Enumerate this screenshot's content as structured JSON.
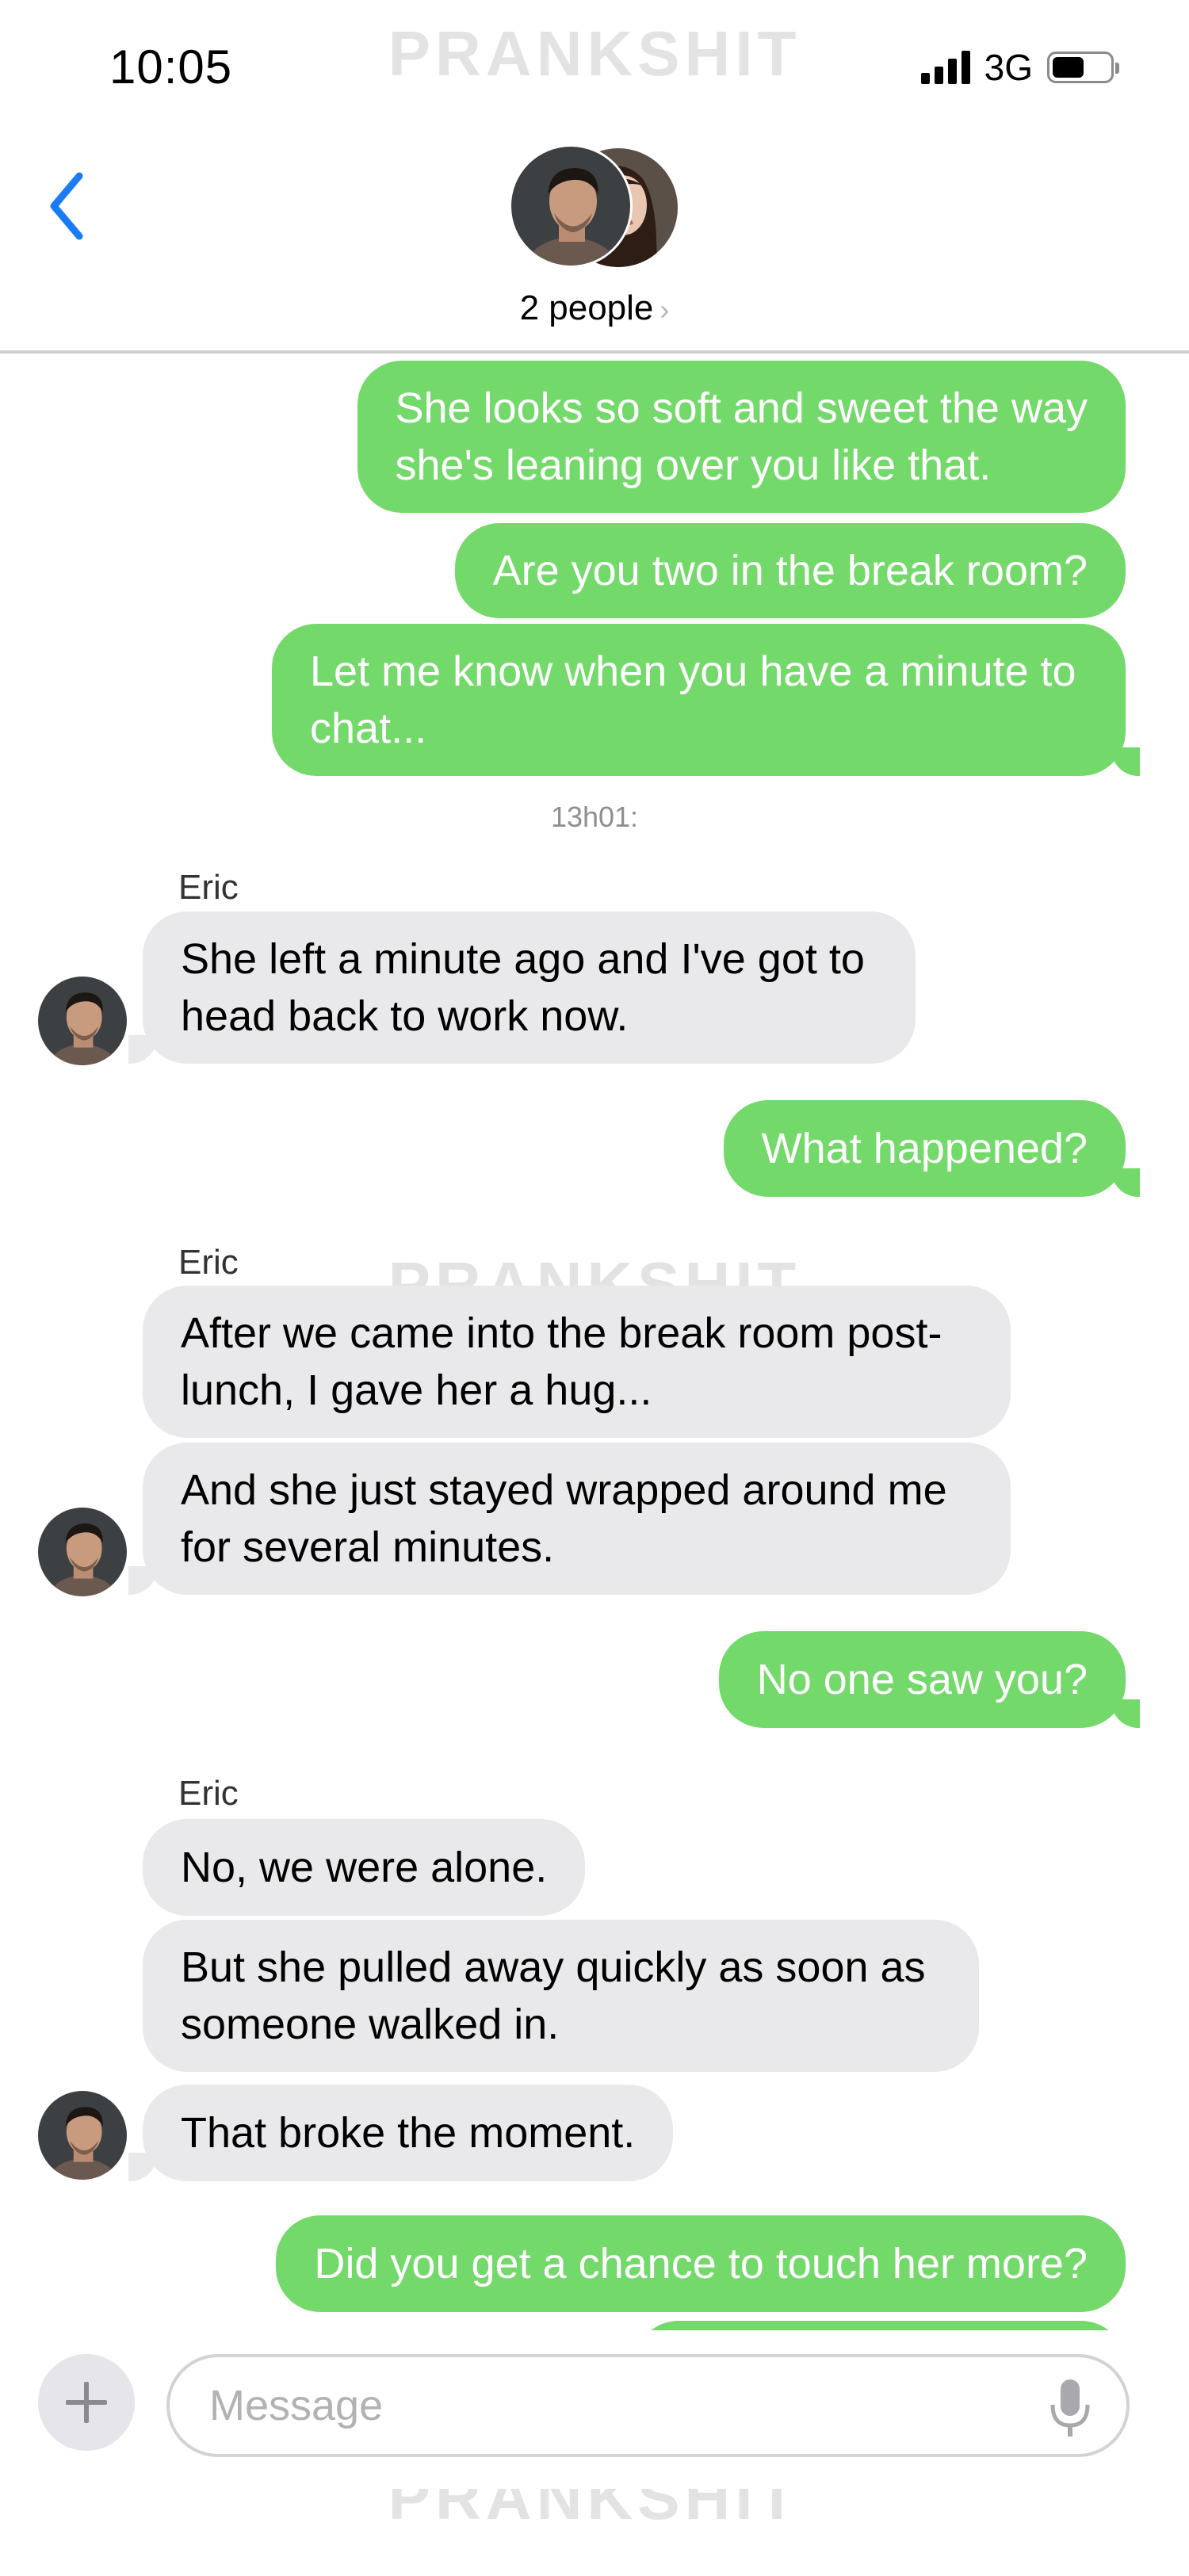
{
  "status_bar": {
    "time": "10:05",
    "network": "3G",
    "battery_level": 0.55
  },
  "header": {
    "people_label": "2 people",
    "chevron": "›"
  },
  "watermark": "PRANKSHIT",
  "messages": [
    {
      "dir": "out",
      "lines": [
        "She looks so soft and sweet the way",
        "she's leaning over you like that."
      ]
    },
    {
      "dir": "out",
      "lines": [
        "Are you two in the break room?"
      ]
    },
    {
      "dir": "out",
      "lines": [
        "Let me know when you have a minute to",
        "chat..."
      ]
    },
    {
      "type": "time",
      "text": "13h01:"
    },
    {
      "type": "sender",
      "text": "Eric"
    },
    {
      "dir": "in",
      "lines": [
        "She left a minute ago and I've got to",
        "head back to work now."
      ]
    },
    {
      "dir": "out",
      "lines": [
        "What happened?"
      ]
    },
    {
      "type": "sender",
      "text": "Eric"
    },
    {
      "dir": "in",
      "lines": [
        "After we came into the break room post-",
        "lunch, I gave her a hug..."
      ]
    },
    {
      "dir": "in",
      "lines": [
        "And she just stayed wrapped around me",
        "for several minutes."
      ]
    },
    {
      "dir": "out",
      "lines": [
        "No one saw you?"
      ]
    },
    {
      "type": "sender",
      "text": "Eric"
    },
    {
      "dir": "in",
      "lines": [
        "No, we were alone."
      ]
    },
    {
      "dir": "in",
      "lines": [
        "But she pulled away quickly as soon as",
        "someone walked in."
      ]
    },
    {
      "dir": "in",
      "lines": [
        "That broke the moment."
      ]
    },
    {
      "dir": "out",
      "lines": [
        "Did you get a chance to touch her more?"
      ]
    }
  ],
  "composer": {
    "placeholder": "Message"
  },
  "colors": {
    "outgoing": "#74d96b",
    "incoming": "#e9e9eb",
    "accent": "#1a7cf5"
  },
  "icons": {
    "back": "chevron-left-icon",
    "add": "plus-icon",
    "mic": "microphone-icon"
  }
}
